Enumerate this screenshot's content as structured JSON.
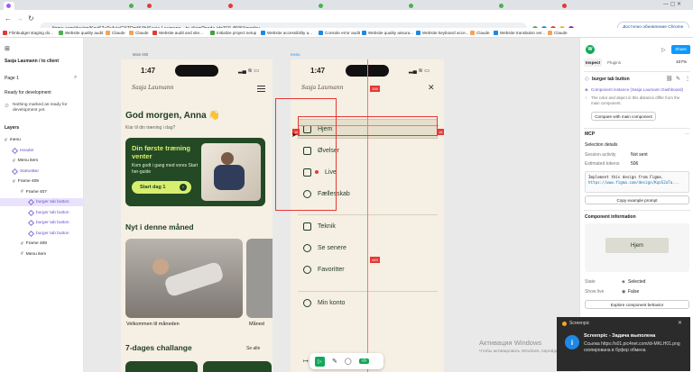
{
  "browser": {
    "url": "figma.com/design/KqzS2aTa4vicGYZOmIK4b/Sasja-Laumann---to-client?node-id=310-4506&m=dev",
    "update_label": "Доступно обновление Chrome",
    "bookmarks": [
      "Flimbudget staging do...",
      "Website quality audit",
      "Claude",
      "Claude",
      "Website audit and site...",
      "Initialize project setup",
      "Website accessibility a...",
      "Console error audit",
      "Website quality assura...",
      "Website keyboard acce...",
      "Claude",
      "Website translation ver...",
      "Claude"
    ]
  },
  "left_panel": {
    "project": "Sasja Laumann / to client",
    "page": "Page 1",
    "ready_label": "Ready for development",
    "notice": "Nothing marked as ready for development yet.",
    "layers_title": "Layers",
    "layers": [
      {
        "label": "menu",
        "indent": 0,
        "kind": "frame",
        "sel": false
      },
      {
        "label": "Header",
        "indent": 1,
        "kind": "comp",
        "sel": false
      },
      {
        "label": "Menu item",
        "indent": 1,
        "kind": "frame",
        "sel": false
      },
      {
        "label": "StatusBar",
        "indent": 1,
        "kind": "comp",
        "sel": false
      },
      {
        "label": "Frame 409",
        "indent": 1,
        "kind": "frame",
        "sel": false
      },
      {
        "label": "Frame 407",
        "indent": 2,
        "kind": "frame",
        "sel": false
      },
      {
        "label": "burger tab button",
        "indent": 3,
        "kind": "comp",
        "sel": true
      },
      {
        "label": "burger tab button",
        "indent": 3,
        "kind": "comp",
        "sel": false
      },
      {
        "label": "burger tab button",
        "indent": 3,
        "kind": "comp",
        "sel": false
      },
      {
        "label": "burger tab button",
        "indent": 3,
        "kind": "comp",
        "sel": false
      },
      {
        "label": "Frame 408",
        "indent": 2,
        "kind": "frame",
        "sel": false
      },
      {
        "label": "Menu item",
        "indent": 2,
        "kind": "frame",
        "sel": false
      }
    ]
  },
  "canvas": {
    "frame1_label": "Main 000",
    "frame2_label": "menu",
    "phone_time": "1:47",
    "logo": "Sasja Laumann",
    "greeting": "God morgen, Anna",
    "greeting_emoji": "👋",
    "subgreeting": "Klar til din træning i dag?",
    "card_title": "Din første træning venter",
    "card_text": "Kom godt i gang med vores Start her-guide",
    "card_button": "Start dag 1",
    "section_new": "Nyt i denne måned",
    "caption1": "Velkommen til måneden",
    "caption2": "Måned",
    "section_challenge": "7-dages challange",
    "see_all": "Se alle",
    "menu_items": [
      "Hjem",
      "Øvelser",
      "Live",
      "Fællesskab"
    ],
    "menu_items2": [
      "Teknik",
      "Se senere",
      "Favoritter"
    ],
    "menu_account": "Min konto",
    "measure_top": "158",
    "measure_left": "16",
    "measure_right": "16",
    "measure_bottom": "449"
  },
  "right_panel": {
    "avatar": "W",
    "share": "Share",
    "zoom": "107%",
    "tab_inspect": "Inspect",
    "tab_plugins": "Plugins",
    "component_title": "burger tab button",
    "instance_label": "Component instance (Sasja Laumann Dashboard)",
    "instance_note": "The color and depict in this distance differ from the main component.",
    "compare_btn": "Compare with main component",
    "mcp_title": "MCP",
    "sel_details": "Selection details",
    "session_label": "Session activity",
    "session_value": "Not sent",
    "tokens_label": "Estimated tokens",
    "tokens_value": "506",
    "code_line1": "Implement this design from Figma.",
    "code_line2": "https://www.figma.com/design/KqzS2aTa...",
    "copy_btn": "Copy example prompt",
    "comp_info": "Component information",
    "preview_label": "Hjem",
    "state_label": "State",
    "state_value": "Selected",
    "showlive_label": "Show live",
    "showlive_value": "False",
    "explore_btn": "Explore component behavior"
  },
  "notification": {
    "app": "Screenpic",
    "title": "Screenpic - Задача выполена",
    "body": "Ссылка https://s01.pic4net.com/di-MKLH01.png скопирована в буфер обмена"
  },
  "watermark": {
    "title": "Активация Windows",
    "sub": "Чтобы активировать Windows, перейдите в раздел"
  },
  "colors": {
    "dark_green": "#1e3d24",
    "card_green": "#234a25",
    "lime": "#d7ee6f",
    "cream": "#f6efe3",
    "selection": "#e53935",
    "figma_blue": "#0d99ff"
  }
}
